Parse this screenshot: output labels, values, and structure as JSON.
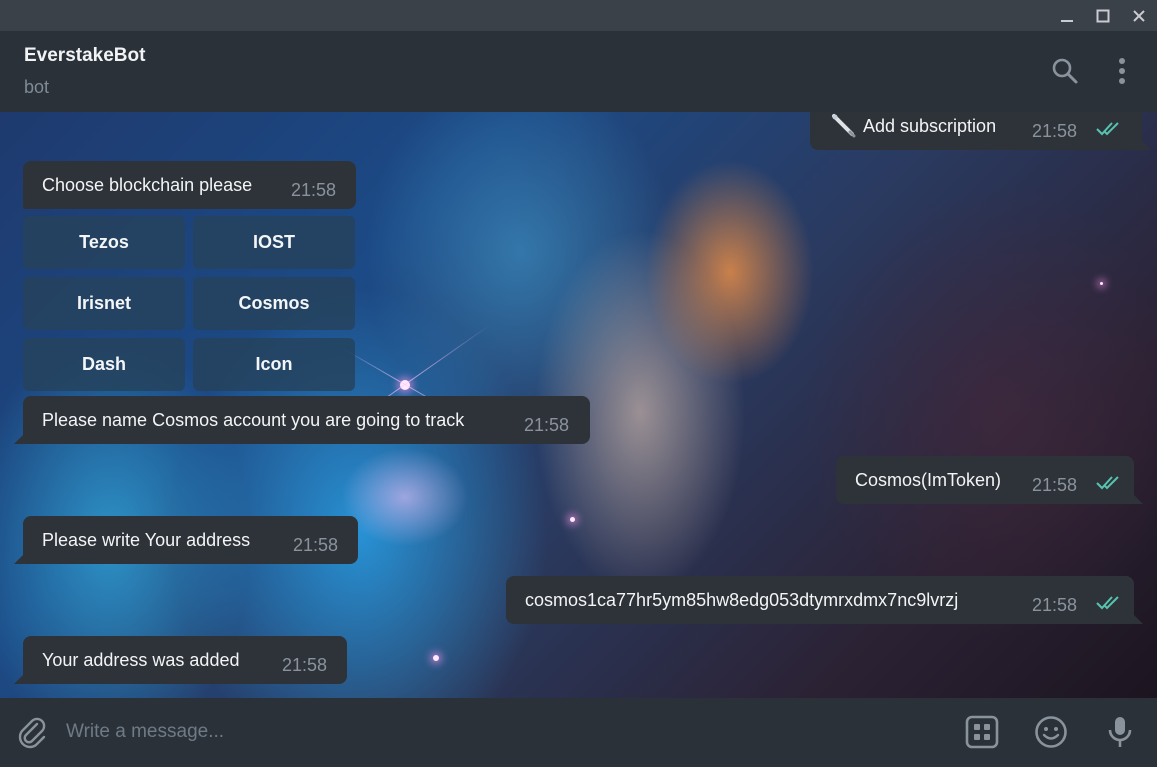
{
  "window": {
    "minimize_icon": "minimize-icon",
    "maximize_icon": "maximize-icon",
    "close_icon": "close-icon"
  },
  "header": {
    "title": "EverstakeBot",
    "status": "bot",
    "search_icon": "search-icon",
    "menu_icon": "more-vertical-icon"
  },
  "messages": [
    {
      "direction": "out",
      "icon": "telescope-emoji",
      "text": "Add subscription",
      "time": "21:58",
      "read": true
    },
    {
      "direction": "in",
      "text": "Choose blockchain please",
      "time": "21:58"
    },
    {
      "direction": "in",
      "text": "Please name Cosmos account you are going to track",
      "time": "21:58"
    },
    {
      "direction": "out",
      "text": "Cosmos(ImToken)",
      "time": "21:58",
      "read": true
    },
    {
      "direction": "in",
      "text": "Please write Your address",
      "time": "21:58"
    },
    {
      "direction": "out",
      "text": "cosmos1ca77hr5ym85hw8edg053dtymrxdmx7nc9lvrzj",
      "time": "21:58",
      "read": true
    },
    {
      "direction": "in",
      "text": "Your address was added",
      "time": "21:58"
    }
  ],
  "keyboard": [
    [
      "Tezos",
      "IOST"
    ],
    [
      "Irisnet",
      "Cosmos"
    ],
    [
      "Dash",
      "Icon"
    ]
  ],
  "compose": {
    "placeholder": "Write a message...",
    "attach_icon": "paperclip-icon",
    "keyboard_icon": "bot-keyboard-icon",
    "emoji_icon": "emoji-icon",
    "mic_icon": "microphone-icon"
  },
  "colors": {
    "bubble": "#2e3339",
    "read_check": "#56c4b0",
    "header": "#2a3139",
    "titlebar": "#3b4148"
  }
}
